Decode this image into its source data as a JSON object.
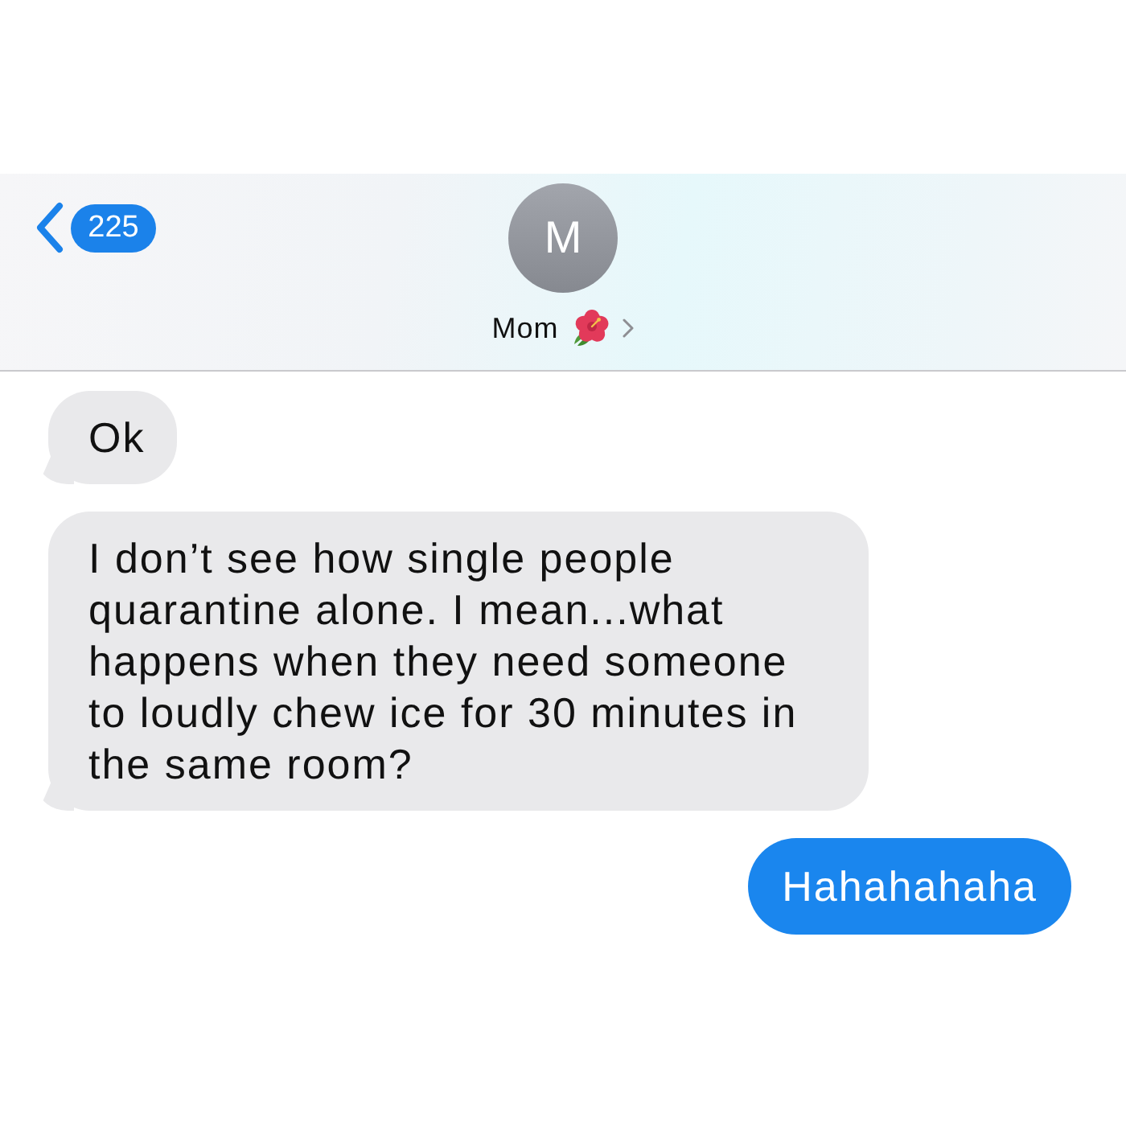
{
  "header": {
    "back": {
      "badge": "225"
    },
    "contact": {
      "initial": "M",
      "name": "Mom"
    }
  },
  "messages": [
    {
      "kind": "received",
      "text": "Ok"
    },
    {
      "kind": "received",
      "text": "I don’t see how single people quarantine alone. I mean...what happens when they need someone to loudly chew ice for 30 minutes in the same room?"
    },
    {
      "kind": "sent",
      "text": "Hahahahaha"
    }
  ]
}
